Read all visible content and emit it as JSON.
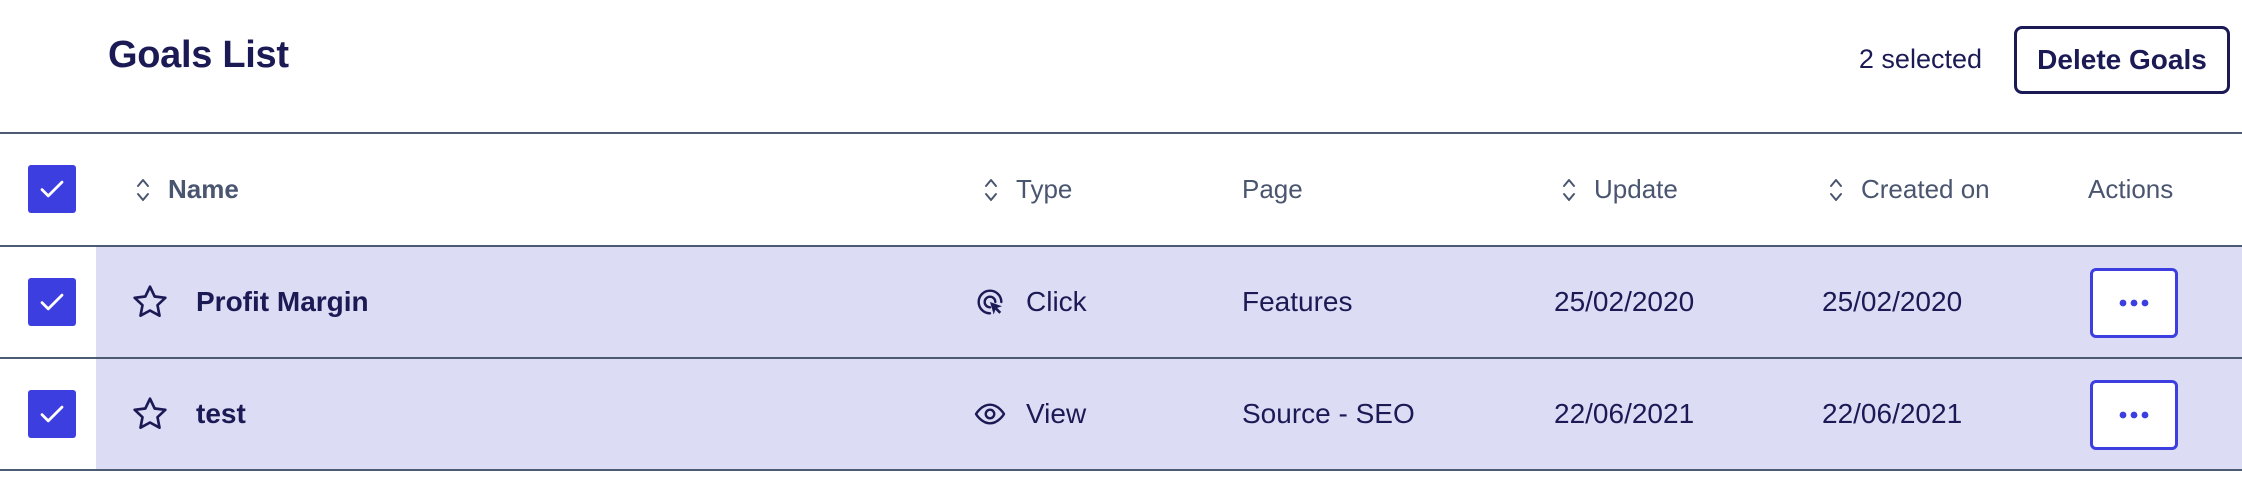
{
  "header": {
    "title": "Goals List",
    "selected_count": "2 selected",
    "delete_label": "Delete Goals"
  },
  "table": {
    "columns": {
      "name": "Name",
      "type": "Type",
      "page": "Page",
      "update": "Update",
      "created_on": "Created on",
      "actions": "Actions"
    },
    "rows": [
      {
        "name": "Profit Margin",
        "type": "Click",
        "type_icon": "cursor-click-icon",
        "page": "Features",
        "update": "25/02/2020",
        "created_on": "25/02/2020",
        "selected": true,
        "starred": false
      },
      {
        "name": "test",
        "type": "View",
        "type_icon": "eye-icon",
        "page": "Source - SEO",
        "update": "22/06/2021",
        "created_on": "22/06/2021",
        "selected": true,
        "starred": false
      }
    ]
  },
  "colors": {
    "accent": "#3d3ee0",
    "text": "#1b1a55",
    "selected_row": "#dcdcf5",
    "divider": "#4c5a73"
  }
}
